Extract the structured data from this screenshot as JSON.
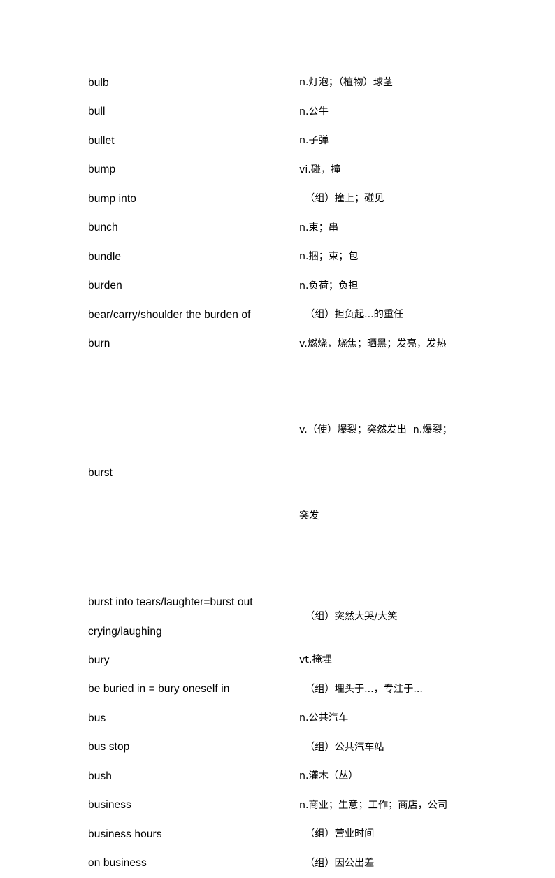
{
  "document": {
    "type": "vocabulary-list",
    "language_pair": "English-Chinese",
    "background_color": "#ffffff",
    "text_color": "#000000"
  },
  "entries": [
    {
      "term": "bulb",
      "definition": "n.灯泡；（植物）球茎",
      "is_phrase": false,
      "lines": 1
    },
    {
      "term": "bull",
      "definition": "n.公牛",
      "is_phrase": false,
      "lines": 1
    },
    {
      "term": "bullet",
      "definition": "n.子弹",
      "is_phrase": false,
      "lines": 1
    },
    {
      "term": "bump",
      "definition": "vi.碰，撞",
      "is_phrase": false,
      "lines": 1
    },
    {
      "term": "bump into",
      "definition": "（组）撞上；碰见",
      "is_phrase": true,
      "lines": 1
    },
    {
      "term": "bunch",
      "definition": "n.束；串",
      "is_phrase": false,
      "lines": 1
    },
    {
      "term": "bundle",
      "definition": "n.捆；束；包",
      "is_phrase": false,
      "lines": 1
    },
    {
      "term": "burden",
      "definition": "n.负荷；负担",
      "is_phrase": false,
      "lines": 1
    },
    {
      "term": "bear/carry/shoulder the burden of",
      "definition": "（组）担负起...的重任",
      "is_phrase": true,
      "lines": 1
    },
    {
      "term": "burn",
      "definition": "v.燃烧，烧焦；晒黑；发亮，发热",
      "is_phrase": false,
      "lines": 1
    },
    {
      "term": "burst",
      "definition_line1": "v.（使）爆裂；突然发出  n.爆裂；",
      "definition_line2": "突发",
      "is_phrase": false,
      "lines": 2
    },
    {
      "term_line1": "burst into tears/laughter=burst out",
      "term_line2": "crying/laughing",
      "definition": "（组）突然大哭/大笑",
      "is_phrase": true,
      "lines": 2
    },
    {
      "term": "bury",
      "definition": "vt.掩埋",
      "is_phrase": false,
      "lines": 1
    },
    {
      "term": "be buried in = bury oneself in",
      "definition": "（组）埋头于...，专注于...",
      "is_phrase": true,
      "lines": 1
    },
    {
      "term": "bus",
      "definition": "n.公共汽车",
      "is_phrase": false,
      "lines": 1
    },
    {
      "term": "bus stop",
      "definition": "（组）公共汽车站",
      "is_phrase": true,
      "lines": 1
    },
    {
      "term": "bush",
      "definition": "n.灌木（丛）",
      "is_phrase": false,
      "lines": 1
    },
    {
      "term": "business",
      "definition": "n.商业；生意；工作；商店，公司",
      "is_phrase": false,
      "lines": 1
    },
    {
      "term": "business hours",
      "definition": "（组）营业时间",
      "is_phrase": true,
      "lines": 1
    },
    {
      "term": "on business",
      "definition": "（组）因公出差",
      "is_phrase": true,
      "lines": 1
    }
  ]
}
